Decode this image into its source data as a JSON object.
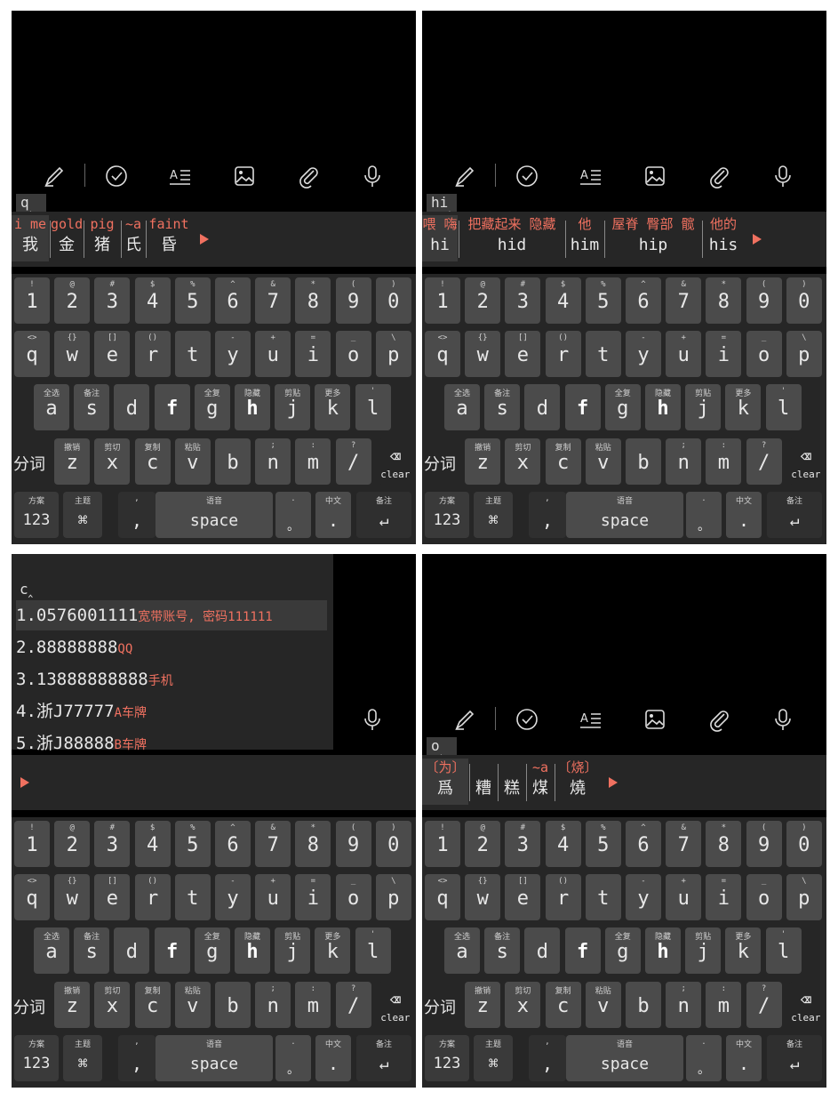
{
  "panels": [
    {
      "id": "p1",
      "composition": "q",
      "candidates": [
        {
          "hint": "i me",
          "text": "我"
        },
        {
          "hint": "gold",
          "text": "金"
        },
        {
          "hint": "pig",
          "text": "猪"
        },
        {
          "hint": "~a",
          "text": "氏"
        },
        {
          "hint": "faint",
          "text": "昏"
        }
      ]
    },
    {
      "id": "p2",
      "composition": "hi",
      "candidates": [
        {
          "hint": "喂 嗨",
          "text": "hi"
        },
        {
          "hint": "把藏起来 隐藏",
          "text": "hid"
        },
        {
          "hint": "他",
          "text": "him"
        },
        {
          "hint": "屋脊 臀部 髋",
          "text": "hip"
        },
        {
          "hint": "他的",
          "text": "his"
        }
      ]
    },
    {
      "id": "p3",
      "composition": "c",
      "clipboard": [
        {
          "index": "1.",
          "text": "0576001111",
          "note": "宽带账号, 密码111111"
        },
        {
          "index": "2.",
          "text": "88888888",
          "note": "QQ"
        },
        {
          "index": "3.",
          "text": "13888888888",
          "note": "手机"
        },
        {
          "index": "4.",
          "text": "浙J77777",
          "note": "A车牌"
        },
        {
          "index": "5.",
          "text": "浙J88888",
          "note": "B车牌"
        }
      ]
    },
    {
      "id": "p4",
      "composition": "o",
      "candidates": [
        {
          "hint": "〔为〕",
          "text": "爲"
        },
        {
          "hint": "",
          "text": "糟"
        },
        {
          "hint": "",
          "text": "糕"
        },
        {
          "hint": "~a",
          "text": "煤"
        },
        {
          "hint": "〔烧〕",
          "text": "燒"
        }
      ]
    }
  ],
  "keyboard": {
    "number_row": [
      {
        "sup": "!",
        "main": "1"
      },
      {
        "sup": "@",
        "main": "2"
      },
      {
        "sup": "#",
        "main": "3"
      },
      {
        "sup": "$",
        "main": "4"
      },
      {
        "sup": "%",
        "main": "5"
      },
      {
        "sup": "^",
        "main": "6"
      },
      {
        "sup": "&",
        "main": "7"
      },
      {
        "sup": "*",
        "main": "8"
      },
      {
        "sup": "(",
        "main": "9"
      },
      {
        "sup": ")",
        "main": "0"
      }
    ],
    "row_q": [
      {
        "sup": "<>",
        "main": "q"
      },
      {
        "sup": "{}",
        "main": "w"
      },
      {
        "sup": "[]",
        "main": "e"
      },
      {
        "sup": "()",
        "main": "r"
      },
      {
        "sup": "",
        "main": "t"
      },
      {
        "sup": "-",
        "main": "y"
      },
      {
        "sup": "+",
        "main": "u"
      },
      {
        "sup": "=",
        "main": "i"
      },
      {
        "sup": "_",
        "main": "o"
      },
      {
        "sup": "\\",
        "main": "p"
      }
    ],
    "row_a": [
      {
        "sup": "全选",
        "main": "a"
      },
      {
        "sup": "备注",
        "main": "s"
      },
      {
        "sup": "",
        "main": "d"
      },
      {
        "sup": "",
        "main": "f"
      },
      {
        "sup": "全复",
        "main": "g"
      },
      {
        "sup": "隐藏",
        "main": "h"
      },
      {
        "sup": "剪贴",
        "main": "j"
      },
      {
        "sup": "更多",
        "main": "k"
      },
      {
        "sup": "'",
        "main": "l"
      }
    ],
    "row_z": [
      {
        "sup": "",
        "main": "分词"
      },
      {
        "sup": "撤销",
        "main": "z"
      },
      {
        "sup": "剪切",
        "main": "x"
      },
      {
        "sup": "复制",
        "main": "c"
      },
      {
        "sup": "粘贴",
        "main": "v"
      },
      {
        "sup": "",
        "main": "b"
      },
      {
        "sup": ";",
        "main": "n"
      },
      {
        "sup": ":",
        "main": "m"
      },
      {
        "sup": "?",
        "main": "/"
      },
      {
        "sup": "",
        "main": "⌫",
        "sub": "clear"
      }
    ],
    "bottom_row": [
      {
        "sup": "方案",
        "main": "123"
      },
      {
        "sup": "主题",
        "main": "⌘"
      },
      {
        "sup": ",",
        "main": ","
      },
      {
        "sup": "语音",
        "main": "space"
      },
      {
        "sup": ".",
        "main": "。"
      },
      {
        "sup": "中文",
        "main": "."
      },
      {
        "sup": "备注",
        "main": "↵"
      }
    ]
  },
  "colors": {
    "background": "#000000",
    "keyboard": "#262626",
    "key": "#4b4b4b",
    "accent": "#f07160",
    "text": "#e8e8e8"
  },
  "toolbar_icons": [
    "pen-icon",
    "check-circle-icon",
    "text-format-icon",
    "image-icon",
    "paperclip-icon",
    "microphone-icon"
  ]
}
